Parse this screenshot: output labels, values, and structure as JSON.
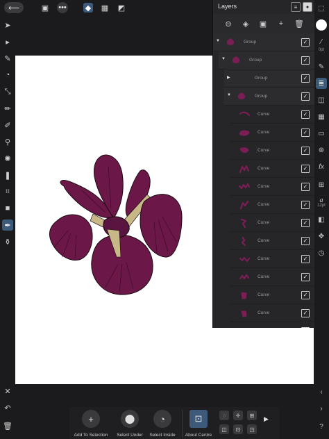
{
  "topbar": {
    "back_icon": "back-arrow-icon",
    "document_icon": "document-icon",
    "more_icon": "more-icon",
    "persona_icons": [
      "designer-persona-icon",
      "pixel-persona-icon",
      "export-persona-icon"
    ]
  },
  "tools": [
    "move-tool-icon",
    "node-tool-icon",
    "pen-tool-icon",
    "corner-tool-icon",
    "transparency-tool-icon",
    "pencil-tool-icon",
    "vector-brush-icon",
    "color-picker-icon",
    "fill-tool-icon",
    "place-image-icon",
    "crop-tool-icon",
    "rectangle-tool-icon",
    "pen-selected-tool-icon",
    "eyedropper-tool-icon"
  ],
  "canvas": {
    "flower_colors": {
      "petal": "#6b1848",
      "petal_dark": "#4a0f31",
      "stem": "#c8b787",
      "outline": "#1a0a12"
    }
  },
  "layers_panel": {
    "title": "Layers",
    "rows": [
      {
        "name": "Group",
        "type": "group",
        "indent": 0,
        "expanded": true
      },
      {
        "name": "Group",
        "type": "group",
        "indent": 1,
        "expanded": true
      },
      {
        "name": "Group",
        "type": "group",
        "indent": 2,
        "expanded": false
      },
      {
        "name": "Group",
        "type": "group",
        "indent": 2,
        "expanded": true
      },
      {
        "name": "Curve",
        "type": "curve",
        "indent": 3
      },
      {
        "name": "Curve",
        "type": "curve",
        "indent": 3
      },
      {
        "name": "Curve",
        "type": "curve",
        "indent": 3
      },
      {
        "name": "Curve",
        "type": "curve",
        "indent": 3
      },
      {
        "name": "Curve",
        "type": "curve",
        "indent": 3
      },
      {
        "name": "Curve",
        "type": "curve",
        "indent": 3
      },
      {
        "name": "Curve",
        "type": "curve",
        "indent": 3
      },
      {
        "name": "Curve",
        "type": "curve",
        "indent": 3
      },
      {
        "name": "Curve",
        "type": "curve",
        "indent": 3
      },
      {
        "name": "Curve",
        "type": "curve",
        "indent": 3
      },
      {
        "name": "Curve",
        "type": "curve",
        "indent": 3
      },
      {
        "name": "Curve",
        "type": "curve",
        "indent": 3
      },
      {
        "name": "Curve",
        "type": "curve",
        "indent": 3
      }
    ],
    "check_mark": "✓",
    "accent_color": "#7a1e55"
  },
  "right_studio": {
    "stroke_label": "0pt",
    "text_size_label": "12pt"
  },
  "bottombar": {
    "add_to_selection": "Add To Selection",
    "select_under": "Select Under",
    "select_inside": "Select Inside",
    "about_centre": "About Centre"
  }
}
